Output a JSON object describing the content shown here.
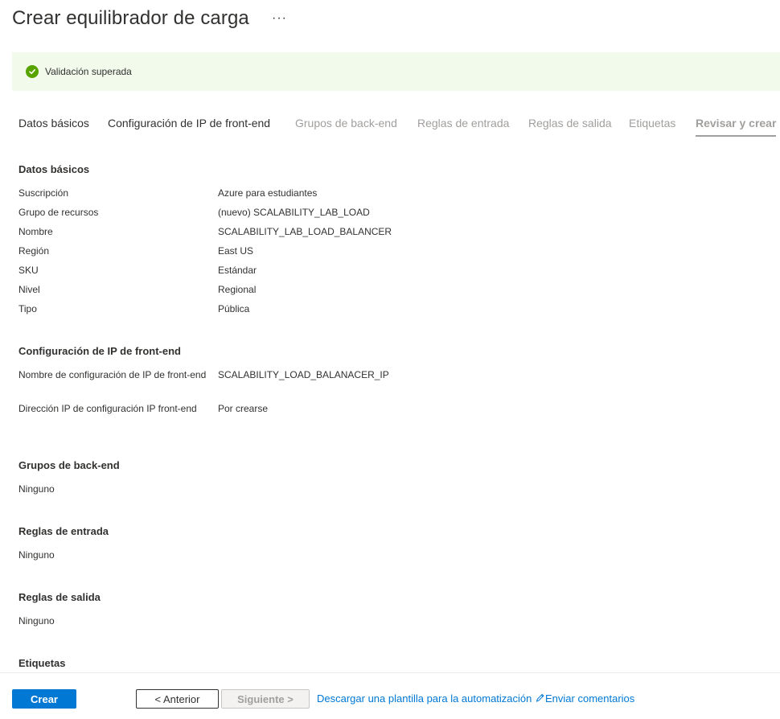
{
  "header": {
    "title": "Crear equilibrador de carga",
    "more": "···"
  },
  "banner": {
    "text": "Validación superada"
  },
  "tabs": [
    {
      "label": "Datos básicos"
    },
    {
      "label": "Configuración de IP de front-end"
    },
    {
      "label": "Grupos de back-end"
    },
    {
      "label": "Reglas de entrada"
    },
    {
      "label": "Reglas de salida"
    },
    {
      "label": "Etiquetas"
    },
    {
      "label": "Revisar y crear"
    }
  ],
  "basics": {
    "title": "Datos básicos",
    "rows": [
      {
        "label": "Suscripción",
        "value": "Azure para estudiantes"
      },
      {
        "label": "Grupo de recursos",
        "value": "(nuevo) SCALABILITY_LAB_LOAD"
      },
      {
        "label": "Nombre",
        "value": "SCALABILITY_LAB_LOAD_BALANCER"
      },
      {
        "label": "Región",
        "value": "East US"
      },
      {
        "label": "SKU",
        "value": "Estándar"
      },
      {
        "label": "Nivel",
        "value": "Regional"
      },
      {
        "label": "Tipo",
        "value": "Pública"
      }
    ]
  },
  "frontend": {
    "title": "Configuración de IP de front-end",
    "rows": [
      {
        "label": "Nombre de configuración de IP de front-end",
        "value": "SCALABILITY_LOAD_BALANACER_IP"
      },
      {
        "label": "Dirección IP de configuración IP front-end",
        "value": "Por crearse"
      }
    ]
  },
  "backend": {
    "title": "Grupos de back-end",
    "value": "Ninguno"
  },
  "inbound": {
    "title": "Reglas de entrada",
    "value": "Ninguno"
  },
  "outbound": {
    "title": "Reglas de salida",
    "value": "Ninguno"
  },
  "tags": {
    "title": "Etiquetas"
  },
  "footer": {
    "create": "Crear",
    "previous": "< Anterior",
    "next": "Siguiente >",
    "download": "Descargar una plantilla para la automatización",
    "feedback": "Enviar comentarios"
  },
  "colors": {
    "accent": "#0078d4",
    "success": "#57a300",
    "banner_bg": "#f1faeb"
  }
}
